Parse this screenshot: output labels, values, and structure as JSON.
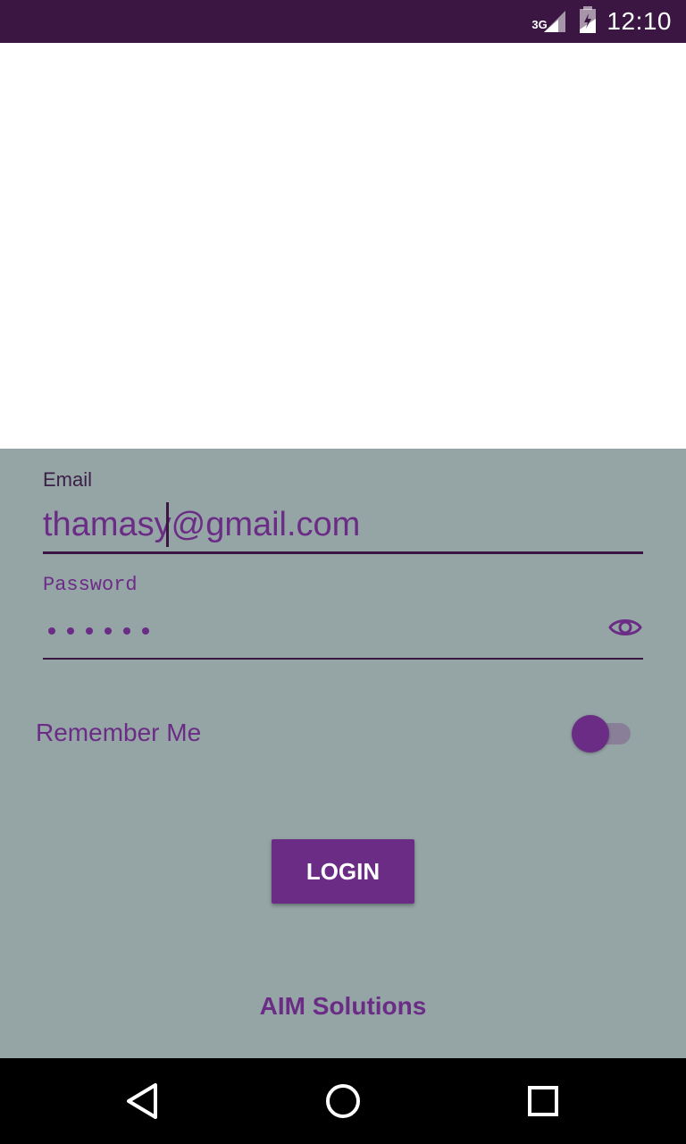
{
  "status_bar": {
    "network": "3G",
    "time": "12:10",
    "background": "#3c1642",
    "icons": [
      "signal-icon",
      "battery-icon"
    ]
  },
  "login_form": {
    "email_label": "Email",
    "email_value": "thamasy@gmail.com",
    "password_label": "Password",
    "password_mask": "••••••",
    "remember_label": "Remember Me",
    "remember_enabled": true,
    "login_label": "LOGIN",
    "brand": "AIM Solutions",
    "accent": "#6b2c85",
    "background": "#95a5a6",
    "password_visibility_icon": "eye-icon"
  },
  "nav_bar": {
    "buttons": [
      "back-icon",
      "home-icon",
      "recents-icon"
    ]
  }
}
